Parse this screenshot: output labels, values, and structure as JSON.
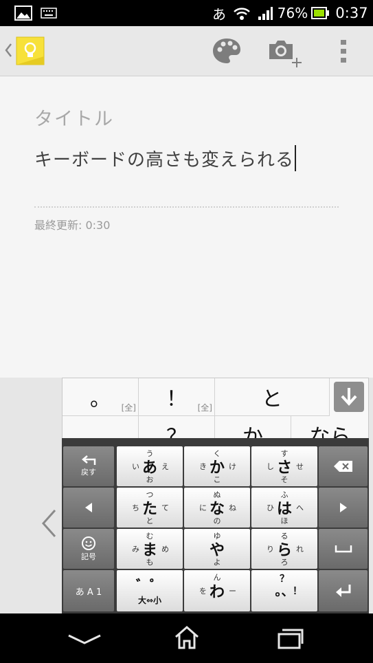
{
  "status_bar": {
    "icons_left": [
      "image-icon",
      "keyboard-icon"
    ],
    "ime_indicator": "あ",
    "battery_percent": "76%",
    "time": "0:37"
  },
  "action_bar": {
    "icons": [
      "back-chevron-icon",
      "keep-bulb-icon",
      "palette-icon",
      "add-photo-icon",
      "overflow-menu-icon"
    ]
  },
  "note": {
    "title_placeholder": "タイトル",
    "body": "キーボードの高さも変えられる",
    "last_edited": "最終更新: 0:30"
  },
  "keyboard": {
    "candidates": [
      {
        "text": "。",
        "tag": "[全]"
      },
      {
        "text": "！",
        "tag": "[全]"
      },
      {
        "text": "と",
        "tag": ""
      },
      {
        "text": "、",
        "tag": ""
      },
      {
        "text": "？",
        "tag": ""
      },
      {
        "text": "か",
        "tag": ""
      },
      {
        "text": "なら",
        "tag": ""
      }
    ],
    "keys": {
      "undo": "戻す",
      "a": {
        "main": "あ",
        "top": "う",
        "left": "い",
        "right": "え",
        "bottom": "お"
      },
      "ka": {
        "main": "か",
        "top": "く",
        "left": "き",
        "right": "け",
        "bottom": "こ"
      },
      "sa": {
        "main": "さ",
        "top": "す",
        "left": "し",
        "right": "せ",
        "bottom": "そ"
      },
      "ta": {
        "main": "た",
        "top": "つ",
        "left": "ち",
        "right": "て",
        "bottom": "と"
      },
      "na": {
        "main": "な",
        "top": "ぬ",
        "left": "に",
        "right": "ね",
        "bottom": "の"
      },
      "ha": {
        "main": "は",
        "top": "ふ",
        "left": "ひ",
        "right": "へ",
        "bottom": "ほ"
      },
      "kigou": "記号",
      "ma": {
        "main": "ま",
        "top": "む",
        "left": "み",
        "right": "め",
        "bottom": "も"
      },
      "ya": {
        "main": "や",
        "top": "ゆ",
        "left": "",
        "right": "",
        "bottom": "よ"
      },
      "ra": {
        "main": "ら",
        "top": "る",
        "left": "り",
        "right": "れ",
        "bottom": "ろ"
      },
      "mode": "あ A 1",
      "dakuten": {
        "main": "゛゜",
        "bottom": "大⇔小"
      },
      "wa": {
        "main": "わ",
        "top": "ん",
        "left": "を",
        "right": "ー",
        "bottom": ""
      },
      "punct": {
        "main": "。、",
        "top": "？",
        "right": "！"
      }
    }
  },
  "nav_bar": {
    "icons": [
      "back-icon",
      "home-icon",
      "recent-apps-icon"
    ]
  }
}
